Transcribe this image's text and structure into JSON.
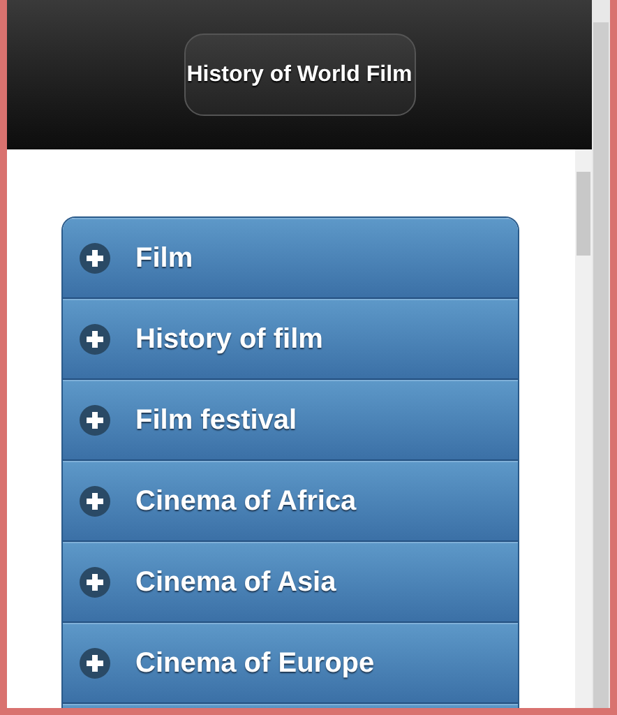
{
  "header": {
    "title": "History of World Film"
  },
  "sections": [
    {
      "label": "Film",
      "expanded": false
    },
    {
      "label": "History of film",
      "expanded": false
    },
    {
      "label": "Film festival",
      "expanded": false
    },
    {
      "label": "Cinema of Africa",
      "expanded": false
    },
    {
      "label": "Cinema of Asia",
      "expanded": false
    },
    {
      "label": "Cinema of Europe",
      "expanded": false
    }
  ]
}
